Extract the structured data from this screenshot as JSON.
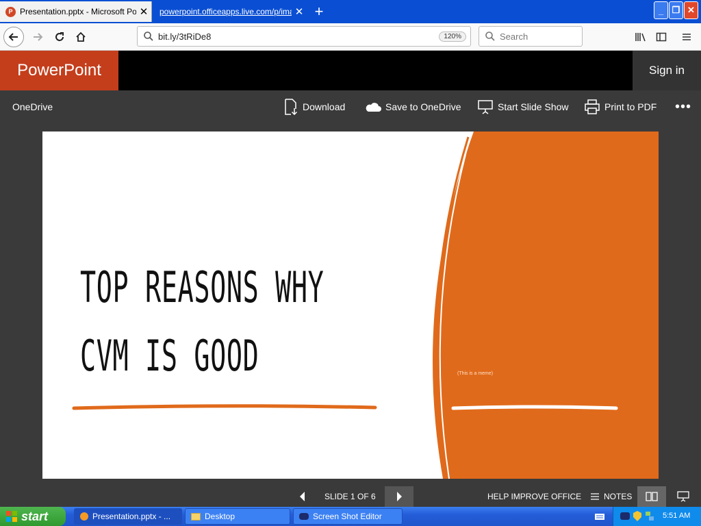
{
  "browser": {
    "tabs": [
      {
        "title": "Presentation.pptx - Microsoft PowerPoint Online",
        "favicon": "P"
      },
      {
        "title": "powerpoint.officeapps.live.com/p/imageviewer"
      }
    ],
    "url": "bit.ly/3tRiDe8",
    "zoom": "120%",
    "search_placeholder": "Search"
  },
  "app": {
    "name": "PowerPoint",
    "sign_in": "Sign in",
    "location": "OneDrive",
    "commands": {
      "download": "Download",
      "save_onedrive": "Save to OneDrive",
      "slideshow": "Start Slide Show",
      "print_pdf": "Print to PDF"
    }
  },
  "slide": {
    "title_line1": "TOP REASONS WHY",
    "title_line2": "CVM IS GOOD",
    "caption": "(This is a meme)",
    "accent_color": "#e06a1b"
  },
  "footer": {
    "slide_indicator": "SLIDE 1 OF 6",
    "help": "HELP IMPROVE OFFICE",
    "notes": "NOTES"
  },
  "taskbar": {
    "start": "start",
    "items": [
      "Presentation.pptx - ...",
      "Desktop",
      "Screen Shot Editor"
    ],
    "clock": "5:51 AM"
  }
}
